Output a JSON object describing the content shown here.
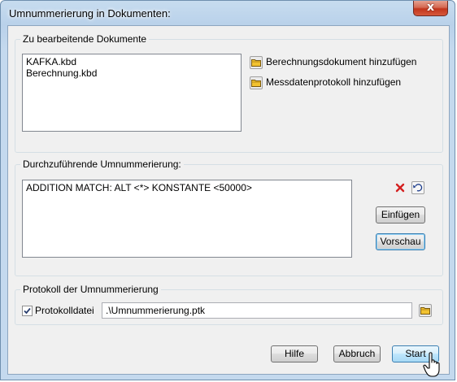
{
  "window": {
    "title": "Umnummerierung in Dokumenten:",
    "close_glyph": "x"
  },
  "documents": {
    "group_title": "Zu bearbeitende Dokumente",
    "files": [
      "KAFKA.kbd",
      "Berechnung.kbd"
    ],
    "add_calc_label": "Berechnungsdokument hinzufügen",
    "add_measure_label": "Messdatenprotokoll hinzufügen",
    "icon": "folder-icon"
  },
  "renumbering": {
    "group_title": "Durchzuführende Umnummerierung:",
    "rules": [
      "ADDITION MATCH: ALT <*> KONSTANTE <50000>"
    ],
    "delete_icon": "delete-x-icon",
    "undo_icon": "undo-icon",
    "insert_label": "Einfügen",
    "preview_label": "Vorschau"
  },
  "protocol": {
    "group_title": "Protokoll der Umnummerierung",
    "checkbox_label": "Protokolldatei",
    "checked": true,
    "file_path": ".\\Umnummerierung.ptk"
  },
  "footer": {
    "help_label": "Hilfe",
    "cancel_label": "Abbruch",
    "start_label": "Start"
  },
  "colors": {
    "delete_red": "#d42020",
    "folder_yellow": "#f2c230",
    "title_bar": "#b9d1ea"
  }
}
